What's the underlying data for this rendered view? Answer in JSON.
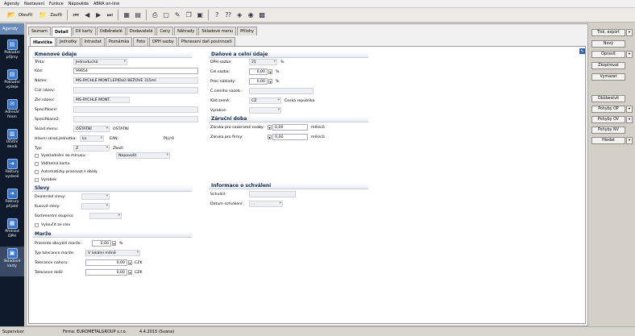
{
  "menu": [
    "Agendy",
    "Nastavení",
    "Funkce",
    "Nápověda",
    "ABRA on-line"
  ],
  "toolbar": {
    "open": "Otevřít",
    "close": "Zavřít"
  },
  "sidebar": {
    "header": "Agendy",
    "items": [
      {
        "l1": "Pokladní",
        "l2": "příjmy"
      },
      {
        "l1": "Pokladní",
        "l2": "výdeje"
      },
      {
        "l1": "Adresář",
        "l2": "firem"
      },
      {
        "l1": "Účetní",
        "l2": "deník"
      },
      {
        "l1": "Faktury",
        "l2": "vydané"
      },
      {
        "l1": "Faktury",
        "l2": "přijaté"
      },
      {
        "l1": "Přehled",
        "l2": "DPH"
      },
      {
        "l1": "Skladové",
        "l2": "karty"
      }
    ]
  },
  "tabs": [
    "Seznam",
    "Detail",
    "Díl karty",
    "Odběratelé",
    "Dodavatelé",
    "Ceny",
    "Náhrady",
    "Skladové menu",
    "Přílohy"
  ],
  "subtabs": [
    "Hlavička",
    "Jednotky",
    "Intrastat",
    "Poznámka",
    "Foto",
    "DPH sazby",
    "Přenesení daň.povinnosti"
  ],
  "left": {
    "kmen": "Kmenové údaje",
    "trida_l": "Třída:",
    "trida_v": "Jednoduchá",
    "kod_l": "Kód:",
    "kod_v": "99654",
    "nazev_l": "Název:",
    "nazev_v": "MS-RYCHLÉ MONT.LEPIDLO BEŽOVÉ 315ml",
    "cizi_l": "Cizí název:",
    "zkr_l": "Zkr.název:",
    "zkr_v": "MS-RYCHLÉ MONT.",
    "spec_l": "Specifikace:",
    "spec2_l": "Specifikace2:",
    "sklmenu_l": "Sklad.menu:",
    "sklmenu_v": "OSTATNÍ",
    "sklmenu_v2": "OSTATNÍ",
    "hlj_l": "Hlavní sklad.jednotka:",
    "hlj_v": "ks",
    "ean_l": "EAN:",
    "plu_l": "PLU:",
    "plu_v": "0",
    "typ_l": "Typ:",
    "typ_v": "Z",
    "typ_v2": "Zboží",
    "c1": "Vyskladnění do mínusu:",
    "c1v": "Nepovolit",
    "c2": "Vážitelná karta",
    "c3": "Automaticky pracovat s obaly",
    "c4": "Výrobek",
    "slevy": "Slevy",
    "deal_l": "Dealerské slevy:",
    "kus_l": "Kusové slevy:",
    "sort_l": "Sortimentní skupina:",
    "vyl_l": "Vyloučit ze slev",
    "marze": "Marže",
    "proc_l": "Procento obvyklé marže:",
    "proc_v": "0,00",
    "pct": "%",
    "typtol_l": "Typ tolerance marže:",
    "typtol_v": "V lokální měně",
    "tnah_l": "Tolerance nahoru:",
    "tnah_v": "0,00",
    "czk1": "CZK",
    "tdol_l": "Tolerance dolů:",
    "tdol_v": "0,00",
    "czk2": "CZK"
  },
  "rightcol": {
    "dan": "Daňové a celní údaje",
    "dph_l": "DPH sazba:",
    "dph_v": "21",
    "dph_p": "%",
    "cel_l": "Cel.sazba:",
    "cel_v": "0,00",
    "cel_p": "%",
    "proc_l": "Proc.náklady:",
    "proc_v": "0,00",
    "proc_p": "%",
    "ccs_l": "Č.celního sazeb.:",
    "kz_l": "Kód země:",
    "kz_v": "CZ",
    "kz_n": "Česká republika",
    "vyr_l": "Výrobce:",
    "zar": "Záruční doba",
    "zo_l": "Záruka pro soukromé osoby:",
    "zo_v": "0,00",
    "zo_u": "měsíců",
    "zf_l": "Záruka pro firmy:",
    "zf_v": "0,00",
    "zf_u": "měsíců",
    "inf": "Informace o schválení",
    "sch_l": "Schválil:",
    "dat_l": "Datum schválení:",
    "dat_v": ". ."
  },
  "buttons": [
    "Tisk, export",
    "Nový",
    "Opravit",
    "Zkopírovat",
    "Vymazat",
    "Obůbestvit",
    "Pohyby OP",
    "Pohyby OV",
    "Pohyby NV",
    "Hledat"
  ],
  "status": {
    "user": "Supervisor",
    "firm": "Firma: EUROMETALGROUP s.r.o.",
    "date": "4.4.2015 (Svana)"
  }
}
